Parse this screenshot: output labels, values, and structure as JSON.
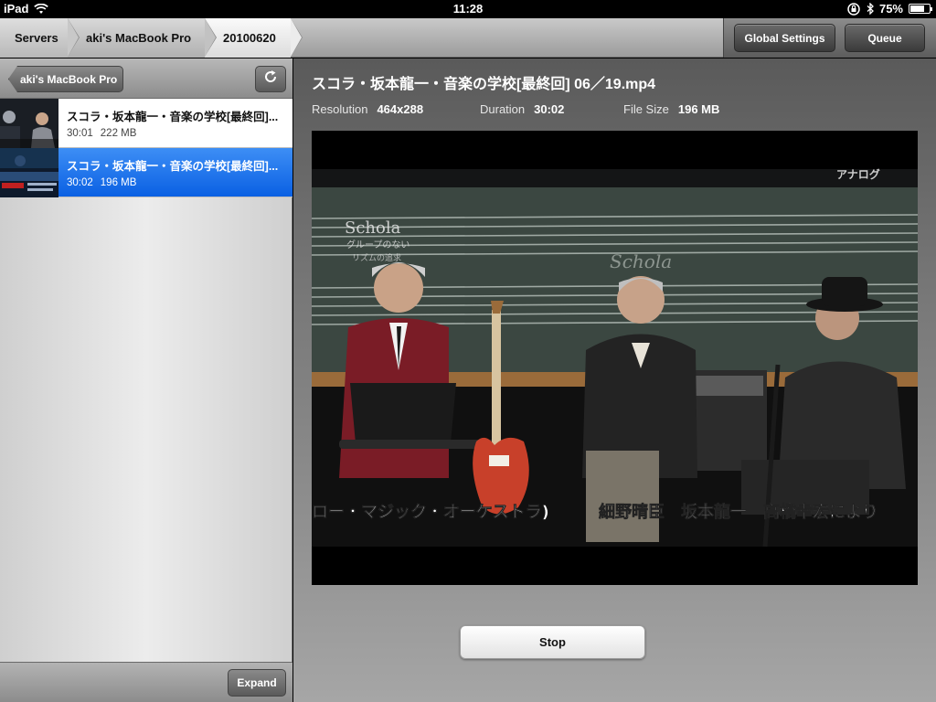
{
  "status": {
    "device": "iPad",
    "time": "11:28",
    "battery": "75%",
    "battery_level": 0.75,
    "icons": [
      "wifi-icon",
      "rotation-lock-icon",
      "bluetooth-icon",
      "battery-icon"
    ]
  },
  "breadcrumbs": {
    "servers": "Servers",
    "computer": "aki's MacBook Pro",
    "folder": "20100620"
  },
  "toolbar": {
    "global_settings": "Global Settings",
    "queue": "Queue"
  },
  "sidebar": {
    "back_label": "aki's MacBook Pro",
    "expand_label": "Expand",
    "items": [
      {
        "title": "スコラ・坂本龍一・音楽の学校[最終回]...",
        "duration": "30:01",
        "size": "222 MB",
        "selected": false
      },
      {
        "title": "スコラ・坂本龍一・音楽の学校[最終回]...",
        "duration": "30:02",
        "size": "196 MB",
        "selected": true
      }
    ]
  },
  "detail": {
    "title": "スコラ・坂本龍一・音楽の学校[最終回] 06／19.mp4",
    "resolution_label": "Resolution",
    "resolution": "464x288",
    "duration_label": "Duration",
    "duration": "30:02",
    "filesize_label": "File Size",
    "filesize": "196 MB",
    "stop_label": "Stop"
  },
  "video": {
    "watermark": "アナログ",
    "board_title": "Schola",
    "board_sub1": "グループのない",
    "board_sub2": "リズムの追求",
    "chalk_text": "Schola",
    "caption_left": "ロー・マジック・オーケストラ)",
    "caption_right": "細野晴臣　坂本龍一　高橋幸宏により"
  },
  "colors": {
    "selection_blue": "#1a6fe8",
    "guitar_red": "#c8402a"
  }
}
